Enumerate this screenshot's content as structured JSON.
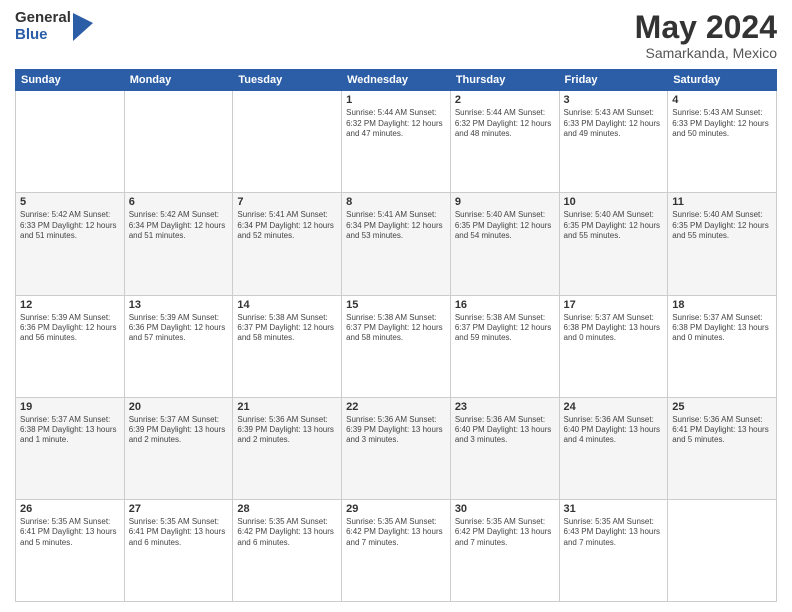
{
  "logo": {
    "general": "General",
    "blue": "Blue"
  },
  "title": "May 2024",
  "subtitle": "Samarkanda, Mexico",
  "days_of_week": [
    "Sunday",
    "Monday",
    "Tuesday",
    "Wednesday",
    "Thursday",
    "Friday",
    "Saturday"
  ],
  "weeks": [
    [
      {
        "day": "",
        "info": ""
      },
      {
        "day": "",
        "info": ""
      },
      {
        "day": "",
        "info": ""
      },
      {
        "day": "1",
        "info": "Sunrise: 5:44 AM\nSunset: 6:32 PM\nDaylight: 12 hours\nand 47 minutes."
      },
      {
        "day": "2",
        "info": "Sunrise: 5:44 AM\nSunset: 6:32 PM\nDaylight: 12 hours\nand 48 minutes."
      },
      {
        "day": "3",
        "info": "Sunrise: 5:43 AM\nSunset: 6:33 PM\nDaylight: 12 hours\nand 49 minutes."
      },
      {
        "day": "4",
        "info": "Sunrise: 5:43 AM\nSunset: 6:33 PM\nDaylight: 12 hours\nand 50 minutes."
      }
    ],
    [
      {
        "day": "5",
        "info": "Sunrise: 5:42 AM\nSunset: 6:33 PM\nDaylight: 12 hours\nand 51 minutes."
      },
      {
        "day": "6",
        "info": "Sunrise: 5:42 AM\nSunset: 6:34 PM\nDaylight: 12 hours\nand 51 minutes."
      },
      {
        "day": "7",
        "info": "Sunrise: 5:41 AM\nSunset: 6:34 PM\nDaylight: 12 hours\nand 52 minutes."
      },
      {
        "day": "8",
        "info": "Sunrise: 5:41 AM\nSunset: 6:34 PM\nDaylight: 12 hours\nand 53 minutes."
      },
      {
        "day": "9",
        "info": "Sunrise: 5:40 AM\nSunset: 6:35 PM\nDaylight: 12 hours\nand 54 minutes."
      },
      {
        "day": "10",
        "info": "Sunrise: 5:40 AM\nSunset: 6:35 PM\nDaylight: 12 hours\nand 55 minutes."
      },
      {
        "day": "11",
        "info": "Sunrise: 5:40 AM\nSunset: 6:35 PM\nDaylight: 12 hours\nand 55 minutes."
      }
    ],
    [
      {
        "day": "12",
        "info": "Sunrise: 5:39 AM\nSunset: 6:36 PM\nDaylight: 12 hours\nand 56 minutes."
      },
      {
        "day": "13",
        "info": "Sunrise: 5:39 AM\nSunset: 6:36 PM\nDaylight: 12 hours\nand 57 minutes."
      },
      {
        "day": "14",
        "info": "Sunrise: 5:38 AM\nSunset: 6:37 PM\nDaylight: 12 hours\nand 58 minutes."
      },
      {
        "day": "15",
        "info": "Sunrise: 5:38 AM\nSunset: 6:37 PM\nDaylight: 12 hours\nand 58 minutes."
      },
      {
        "day": "16",
        "info": "Sunrise: 5:38 AM\nSunset: 6:37 PM\nDaylight: 12 hours\nand 59 minutes."
      },
      {
        "day": "17",
        "info": "Sunrise: 5:37 AM\nSunset: 6:38 PM\nDaylight: 13 hours\nand 0 minutes."
      },
      {
        "day": "18",
        "info": "Sunrise: 5:37 AM\nSunset: 6:38 PM\nDaylight: 13 hours\nand 0 minutes."
      }
    ],
    [
      {
        "day": "19",
        "info": "Sunrise: 5:37 AM\nSunset: 6:38 PM\nDaylight: 13 hours\nand 1 minute."
      },
      {
        "day": "20",
        "info": "Sunrise: 5:37 AM\nSunset: 6:39 PM\nDaylight: 13 hours\nand 2 minutes."
      },
      {
        "day": "21",
        "info": "Sunrise: 5:36 AM\nSunset: 6:39 PM\nDaylight: 13 hours\nand 2 minutes."
      },
      {
        "day": "22",
        "info": "Sunrise: 5:36 AM\nSunset: 6:39 PM\nDaylight: 13 hours\nand 3 minutes."
      },
      {
        "day": "23",
        "info": "Sunrise: 5:36 AM\nSunset: 6:40 PM\nDaylight: 13 hours\nand 3 minutes."
      },
      {
        "day": "24",
        "info": "Sunrise: 5:36 AM\nSunset: 6:40 PM\nDaylight: 13 hours\nand 4 minutes."
      },
      {
        "day": "25",
        "info": "Sunrise: 5:36 AM\nSunset: 6:41 PM\nDaylight: 13 hours\nand 5 minutes."
      }
    ],
    [
      {
        "day": "26",
        "info": "Sunrise: 5:35 AM\nSunset: 6:41 PM\nDaylight: 13 hours\nand 5 minutes."
      },
      {
        "day": "27",
        "info": "Sunrise: 5:35 AM\nSunset: 6:41 PM\nDaylight: 13 hours\nand 6 minutes."
      },
      {
        "day": "28",
        "info": "Sunrise: 5:35 AM\nSunset: 6:42 PM\nDaylight: 13 hours\nand 6 minutes."
      },
      {
        "day": "29",
        "info": "Sunrise: 5:35 AM\nSunset: 6:42 PM\nDaylight: 13 hours\nand 7 minutes."
      },
      {
        "day": "30",
        "info": "Sunrise: 5:35 AM\nSunset: 6:42 PM\nDaylight: 13 hours\nand 7 minutes."
      },
      {
        "day": "31",
        "info": "Sunrise: 5:35 AM\nSunset: 6:43 PM\nDaylight: 13 hours\nand 7 minutes."
      },
      {
        "day": "",
        "info": ""
      }
    ]
  ]
}
